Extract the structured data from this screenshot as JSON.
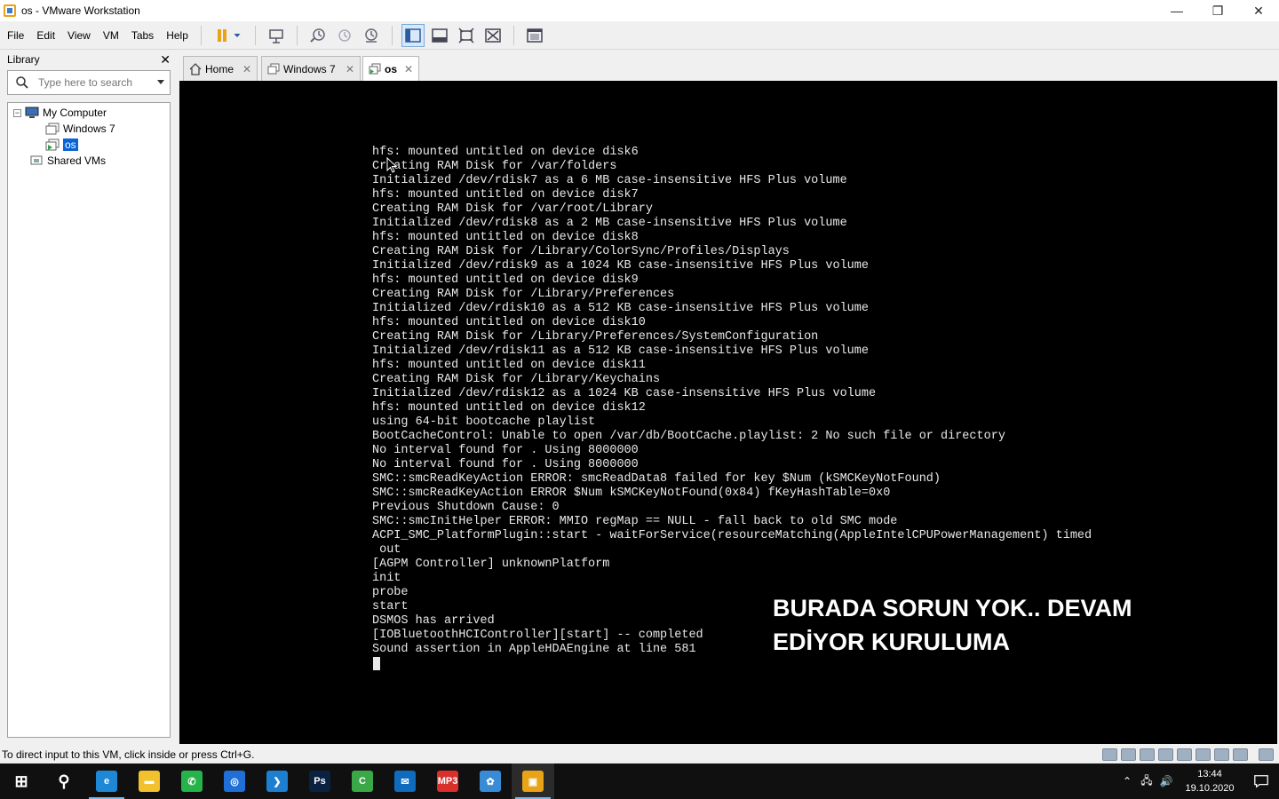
{
  "window": {
    "title": "os - VMware Workstation"
  },
  "window_controls": {
    "minimize": "—",
    "restore": "❐",
    "close": "✕"
  },
  "menu": [
    "File",
    "Edit",
    "View",
    "VM",
    "Tabs",
    "Help"
  ],
  "library": {
    "title": "Library",
    "close": "✕",
    "search_placeholder": "Type here to search",
    "tree": {
      "toggle": "−",
      "my_computer": "My Computer",
      "windows7": "Windows 7",
      "os": "os",
      "shared_vms": "Shared VMs"
    }
  },
  "tabs": [
    {
      "label": "Home",
      "close": "✕"
    },
    {
      "label": "Windows 7",
      "close": "✕"
    },
    {
      "label": "os",
      "close": "✕"
    }
  ],
  "console": {
    "lines": [
      "hfs: mounted untitled on device disk6",
      "Creating RAM Disk for /var/folders",
      "Initialized /dev/rdisk7 as a 6 MB case-insensitive HFS Plus volume",
      "hfs: mounted untitled on device disk7",
      "Creating RAM Disk for /var/root/Library",
      "Initialized /dev/rdisk8 as a 2 MB case-insensitive HFS Plus volume",
      "hfs: mounted untitled on device disk8",
      "Creating RAM Disk for /Library/ColorSync/Profiles/Displays",
      "Initialized /dev/rdisk9 as a 1024 KB case-insensitive HFS Plus volume",
      "hfs: mounted untitled on device disk9",
      "Creating RAM Disk for /Library/Preferences",
      "Initialized /dev/rdisk10 as a 512 KB case-insensitive HFS Plus volume",
      "hfs: mounted untitled on device disk10",
      "Creating RAM Disk for /Library/Preferences/SystemConfiguration",
      "Initialized /dev/rdisk11 as a 512 KB case-insensitive HFS Plus volume",
      "hfs: mounted untitled on device disk11",
      "Creating RAM Disk for /Library/Keychains",
      "Initialized /dev/rdisk12 as a 1024 KB case-insensitive HFS Plus volume",
      "hfs: mounted untitled on device disk12",
      "using 64-bit bootcache playlist",
      "BootCacheControl: Unable to open /var/db/BootCache.playlist: 2 No such file or directory",
      "No interval found for . Using 8000000",
      "No interval found for . Using 8000000",
      "SMC::smcReadKeyAction ERROR: smcReadData8 failed for key $Num (kSMCKeyNotFound)",
      "SMC::smcReadKeyAction ERROR $Num kSMCKeyNotFound(0x84) fKeyHashTable=0x0",
      "Previous Shutdown Cause: 0",
      "SMC::smcInitHelper ERROR: MMIO regMap == NULL - fall back to old SMC mode",
      "ACPI_SMC_PlatformPlugin::start - waitForService(resourceMatching(AppleIntelCPUPowerManagement) timed",
      " out",
      "[AGPM Controller] unknownPlatform",
      "init",
      "probe",
      "start",
      "DSMOS has arrived",
      "[IOBluetoothHCIController][start] -- completed",
      "Sound assertion in AppleHDAEngine at line 581"
    ],
    "overlay": "BURADA SORUN YOK.. DEVAM EDİYOR KURULUMA"
  },
  "statusbar": {
    "message": "To direct input to this VM, click inside or press Ctrl+G."
  },
  "taskbar": {
    "apps": [
      {
        "name": "start",
        "glyph": "⊞",
        "color": "#101010"
      },
      {
        "name": "search",
        "glyph": "⚲",
        "color": "#101010"
      },
      {
        "name": "edge",
        "glyph": "e",
        "color": "#1e88d6"
      },
      {
        "name": "explorer",
        "glyph": "▬",
        "color": "#f2c12e"
      },
      {
        "name": "whatsapp",
        "glyph": "✆",
        "color": "#25b34a"
      },
      {
        "name": "instagram",
        "glyph": "◎",
        "color": "#1f6fd6"
      },
      {
        "name": "vscode",
        "glyph": "❯",
        "color": "#1c7fd0"
      },
      {
        "name": "photoshop",
        "glyph": "Ps",
        "color": "#0a2240"
      },
      {
        "name": "camtasia",
        "glyph": "C",
        "color": "#3ba848"
      },
      {
        "name": "mail",
        "glyph": "✉",
        "color": "#0f6cbd"
      },
      {
        "name": "mp3-converter",
        "glyph": "MP3",
        "color": "#d9302c"
      },
      {
        "name": "app-blue",
        "glyph": "✿",
        "color": "#3a8bd6"
      },
      {
        "name": "vmware",
        "glyph": "▣",
        "color": "#e8a317"
      }
    ],
    "clock_time": "13:44",
    "clock_date": "19.10.2020",
    "tray_chevron": "⌃",
    "tray_network": "🖧",
    "tray_volume": "🔊"
  }
}
